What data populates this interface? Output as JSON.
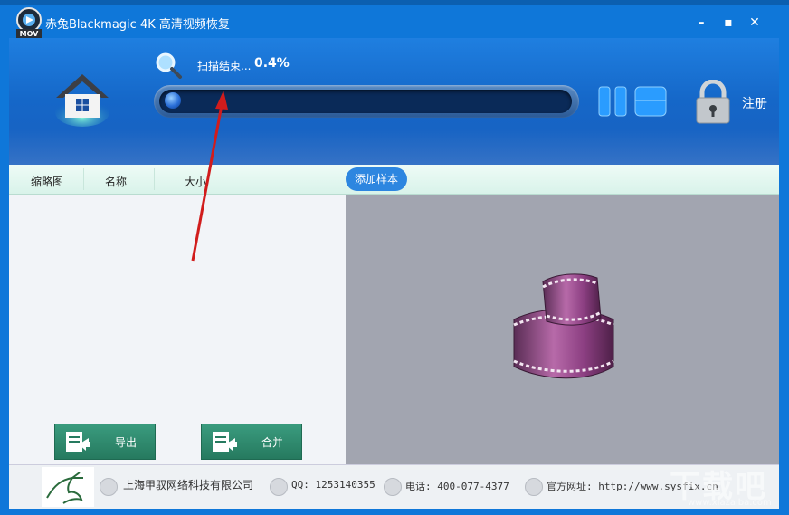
{
  "window": {
    "title": "赤兔Blackmagic 4K 高清视频恢复",
    "icon_label": "MOV"
  },
  "scan": {
    "status_text": "扫描结束...",
    "percent_text": "0.4%",
    "progress": 0.004
  },
  "header": {
    "register_label": "注册"
  },
  "columns": {
    "thumbnail": "缩略图",
    "name": "名称",
    "size": "大小"
  },
  "add_sample_label": "添加样本",
  "buttons": {
    "export": "导出",
    "merge": "合并"
  },
  "footer": {
    "company": "上海甲驭网络科技有限公司",
    "qq": "QQ: 1253140355",
    "phone": "电话: 400-077-4377",
    "website": "官方网址: http://www.sysfix.cn"
  },
  "watermark": {
    "brand": "下载吧",
    "url": "www.xiazaiba.com"
  },
  "colors": {
    "titlebar": "#0f77d9",
    "header": "#1567c8",
    "accent": "#2d86e0",
    "button": "#2f8b6e",
    "preview_bg": "#a2a5b0"
  }
}
